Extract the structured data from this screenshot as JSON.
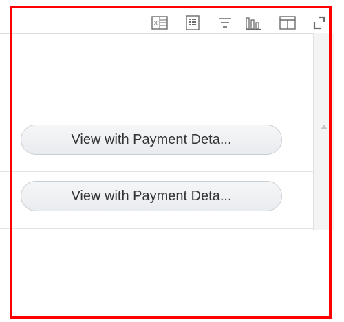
{
  "toolbar": {
    "icons": [
      "excel-export-icon",
      "list-view-icon",
      "filter-icon",
      "chart-icon",
      "layout-columns-icon",
      "expand-icon"
    ]
  },
  "rows": [
    {
      "action_label": "View with Payment Deta..."
    },
    {
      "action_label": "View with Payment Deta..."
    }
  ],
  "colors": {
    "highlight_border": "#ff0000",
    "button_text": "#333333",
    "button_border": "#c9ced4",
    "icon": "#6b6b6b"
  }
}
